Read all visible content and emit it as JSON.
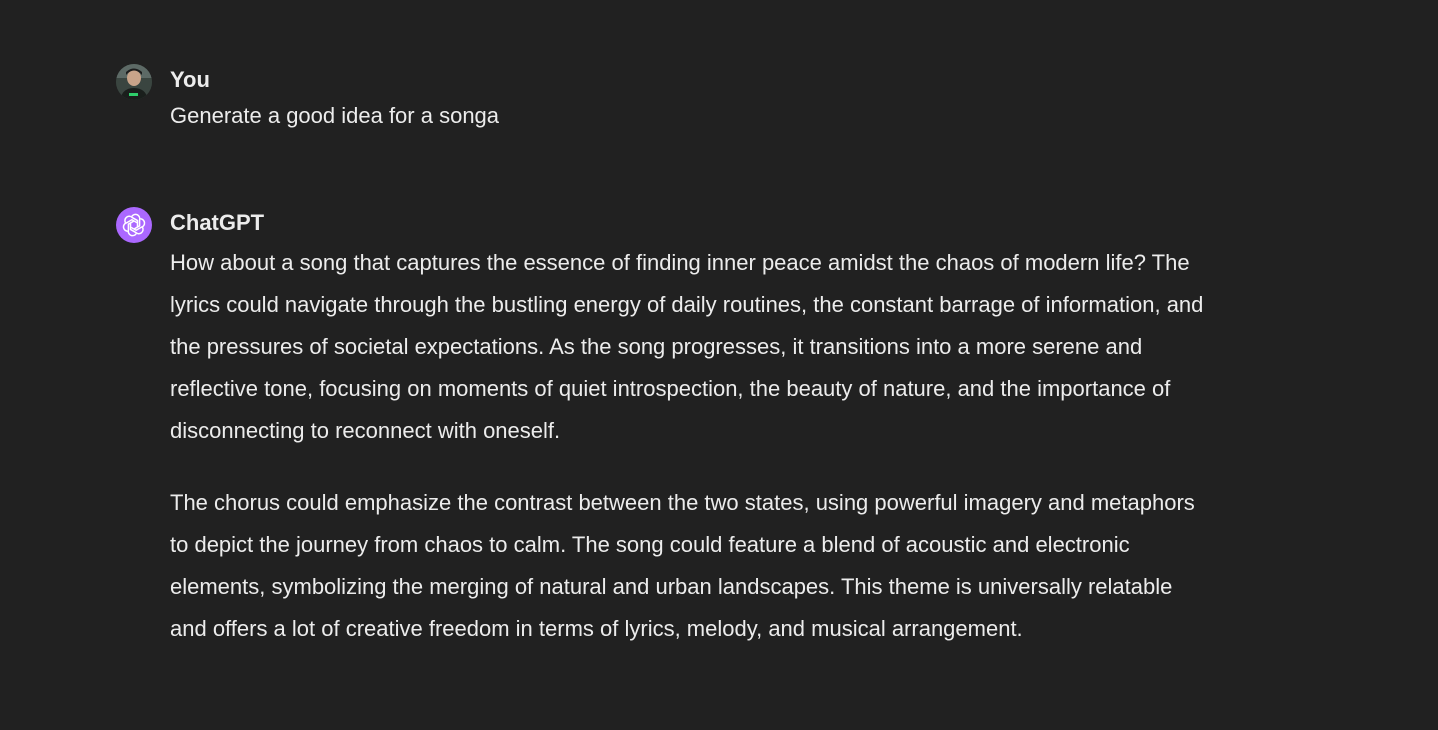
{
  "conversation": {
    "user_message": {
      "author": "You",
      "text": "Generate a good idea for a songa",
      "avatar_icon": "user-photo-avatar"
    },
    "assistant_message": {
      "author": "ChatGPT",
      "avatar_icon": "openai-logo-icon",
      "avatar_color": "#ab68ff",
      "paragraphs": [
        "How about a song that captures the essence of finding inner peace amidst the chaos of modern life? The lyrics could navigate through the bustling energy of daily routines, the constant barrage of information, and the pressures of societal expectations. As the song progresses, it transitions into a more serene and reflective tone, focusing on moments of quiet introspection, the beauty of nature, and the importance of disconnecting to reconnect with oneself.",
        "The chorus could emphasize the contrast between the two states, using powerful imagery and metaphors to depict the journey from chaos to calm. The song could feature a blend of acoustic and electronic elements, symbolizing the merging of natural and urban landscapes. This theme is universally relatable and offers a lot of creative freedom in terms of lyrics, melody, and musical arrangement."
      ]
    }
  },
  "theme": {
    "background": "#212121",
    "text": "#ececec"
  }
}
